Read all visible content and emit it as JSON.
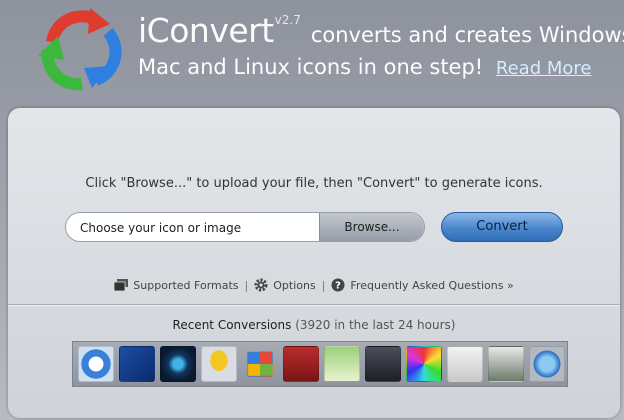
{
  "header": {
    "app_name": "iConvert",
    "version": "v2.7",
    "tagline_line1": "converts and creates Windows,",
    "tagline_line2": "Mac and Linux icons in one step!",
    "read_more_label": "Read More"
  },
  "upload": {
    "instructions": "Click \"Browse...\" to upload your file, then \"Convert\" to generate icons.",
    "file_placeholder": "Choose your icon or image",
    "browse_label": "Browse...",
    "convert_label": "Convert"
  },
  "links": [
    {
      "label": "Supported Formats",
      "icon": "formats-icon"
    },
    {
      "label": "Options",
      "icon": "gear-icon"
    },
    {
      "label": "Frequently Asked Questions »",
      "icon": "question-icon"
    }
  ],
  "recent": {
    "title": "Recent Conversions",
    "count_text": "(3920 in the last 24 hours)",
    "thumbnails": [
      "windows-vista-icon",
      "windows-home-server-icon",
      "windows-start-orb-icon",
      "yellow-figure-icon",
      "windows-flag-icon",
      "dictionary-icon",
      "desktop-screenshot-icon",
      "group-photo-icon",
      "color-wheel-icon",
      "envelope-icon",
      "cs4-screenshot-icon",
      "google-earth-icon"
    ]
  },
  "colors": {
    "background": "#9ca1aa",
    "panel": "#dcdfe3",
    "accent_blue": "#4a86cc",
    "link_blue": "#d6ecff"
  }
}
